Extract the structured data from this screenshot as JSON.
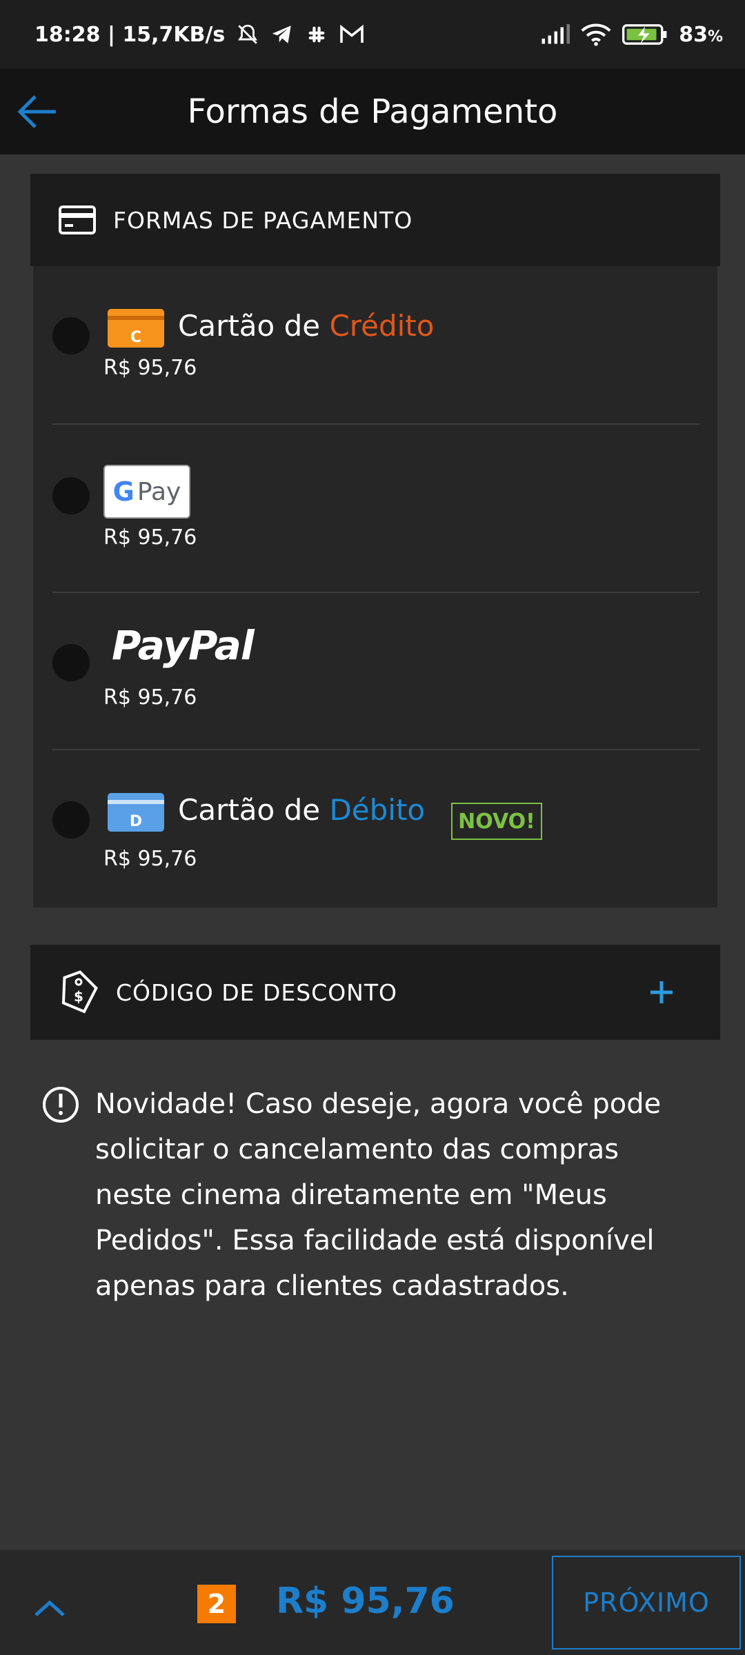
{
  "status_bar": {
    "time_info": "18:28 | 15,7KB/s",
    "battery": "83",
    "battery_unit": "%"
  },
  "app_bar": {
    "title": "Formas de Pagamento"
  },
  "payment_section": {
    "header": "FORMAS DE PAGAMENTO",
    "methods": [
      {
        "title_prefix": "Cartão de ",
        "title_highlight": "Crédito",
        "icon_letter": "C",
        "price": "R$ 95,76"
      },
      {
        "logo_g": "G",
        "logo_pay": "Pay",
        "price": "R$ 95,76"
      },
      {
        "logo": "PayPal",
        "price": "R$ 95,76"
      },
      {
        "title_prefix": "Cartão de ",
        "title_highlight": "Débito",
        "icon_letter": "D",
        "badge": "NOVO!",
        "price": "R$ 95,76"
      }
    ]
  },
  "discount": {
    "label": "CÓDIGO DE DESCONTO",
    "action": "+"
  },
  "notice": {
    "text": "Novidade! Caso deseje, agora você pode solicitar o cancelamento das compras neste cinema diretamente em \"Meus Pedidos\". Essa facilidade está disponível apenas para clientes cadastrados."
  },
  "bottom_bar": {
    "quantity": "2",
    "total": "R$ 95,76",
    "next_label": "PRÓXIMO"
  },
  "colors": {
    "accent_blue": "#1d7ecb",
    "credit_orange": "#e0571c",
    "new_badge_green": "#7cc242"
  }
}
